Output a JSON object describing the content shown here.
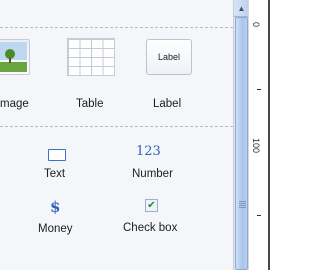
{
  "toolbox": {
    "layout_items": [
      {
        "label": "mage",
        "icon": "image-icon"
      },
      {
        "label": "Table",
        "icon": "table-icon"
      },
      {
        "label": "Label",
        "icon": "label-icon",
        "thumb_text": "Label"
      }
    ],
    "field_items": [
      {
        "label": "Text",
        "icon": "text-field-icon"
      },
      {
        "label": "Number",
        "icon": "number-field-icon",
        "glyph": "123"
      },
      {
        "label": "Money",
        "icon": "money-field-icon",
        "glyph": "$"
      },
      {
        "label": "Check box",
        "icon": "checkbox-field-icon",
        "glyph": "✔"
      }
    ]
  },
  "scrollbar": {
    "up_arrow": "▲"
  },
  "ruler": {
    "labels": [
      "0",
      "100",
      "-",
      "-"
    ]
  },
  "colors": {
    "accent": "#2e62b6",
    "panel_bg": "#f4f6f9",
    "scrollbar": "#a9c4ea"
  }
}
